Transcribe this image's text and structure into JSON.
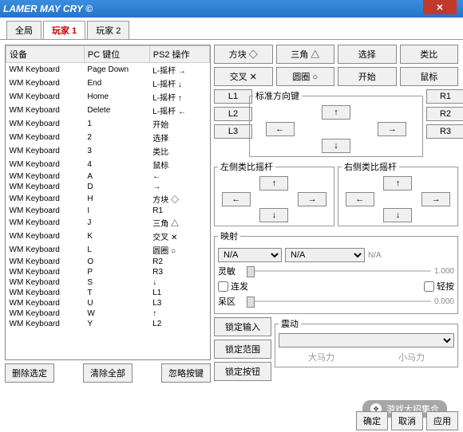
{
  "title": "LAMER MAY CRY ©",
  "tabs": [
    "全局",
    "玩家 1",
    "玩家 2"
  ],
  "activeTab": 1,
  "cols": [
    "设备",
    "PC 键位",
    "PS2 操作"
  ],
  "rows": [
    [
      "WM Keyboard",
      "Page Down",
      "L-摇杆 →"
    ],
    [
      "WM Keyboard",
      "End",
      "L-摇杆 ↓"
    ],
    [
      "WM Keyboard",
      "Home",
      "L-摇杆 ↑"
    ],
    [
      "WM Keyboard",
      "Delete",
      "L-摇杆 ←"
    ],
    [
      "WM Keyboard",
      "1",
      "开始"
    ],
    [
      "WM Keyboard",
      "2",
      "选择"
    ],
    [
      "WM Keyboard",
      "3",
      "类比"
    ],
    [
      "WM Keyboard",
      "4",
      "鼠标"
    ],
    [
      "WM Keyboard",
      "A",
      "←"
    ],
    [
      "WM Keyboard",
      "D",
      "→"
    ],
    [
      "WM Keyboard",
      "H",
      "方块 ◇"
    ],
    [
      "WM Keyboard",
      "I",
      "R1"
    ],
    [
      "WM Keyboard",
      "J",
      "三角 △"
    ],
    [
      "WM Keyboard",
      "K",
      "交叉 ✕"
    ],
    [
      "WM Keyboard",
      "L",
      "圆圈 ○"
    ],
    [
      "WM Keyboard",
      "O",
      "R2"
    ],
    [
      "WM Keyboard",
      "P",
      "R3"
    ],
    [
      "WM Keyboard",
      "S",
      "↓"
    ],
    [
      "WM Keyboard",
      "T",
      "L1"
    ],
    [
      "WM Keyboard",
      "U",
      "L3"
    ],
    [
      "WM Keyboard",
      "W",
      "↑"
    ],
    [
      "WM Keyboard",
      "Y",
      "L2"
    ]
  ],
  "leftBtns": {
    "delSel": "删除选定",
    "clearAll": "清除全部",
    "ignore": "忽略按键"
  },
  "faceBtns": [
    "方块 ◇",
    "三角 △",
    "选择",
    "类比",
    "交叉 ✕",
    "圆圈 ○",
    "开始",
    "鼠标"
  ],
  "dpad": {
    "legend": "标准方向键",
    "L": [
      "L1",
      "L2",
      "L3"
    ],
    "R": [
      "R1",
      "R2",
      "R3"
    ]
  },
  "analog": {
    "left": "左侧类比摇杆",
    "right": "右侧类比摇杆"
  },
  "mapping": {
    "legend": "映射",
    "naSel": "N/A",
    "naText": "N/A",
    "sens": "灵敏",
    "sensVal": "1.000",
    "rapid": "连发",
    "lightPress": "轻按",
    "dead": "呆区",
    "deadVal": "0.000"
  },
  "lock": {
    "input": "锁定输入",
    "range": "锁定范围",
    "button": "锁定按钮"
  },
  "vib": {
    "legend": "震动",
    "big": "大马力",
    "small": "小马力"
  },
  "footer": {
    "ok": "确定",
    "cancel": "取消",
    "apply": "应用"
  },
  "watermark": "游戏大招集合"
}
